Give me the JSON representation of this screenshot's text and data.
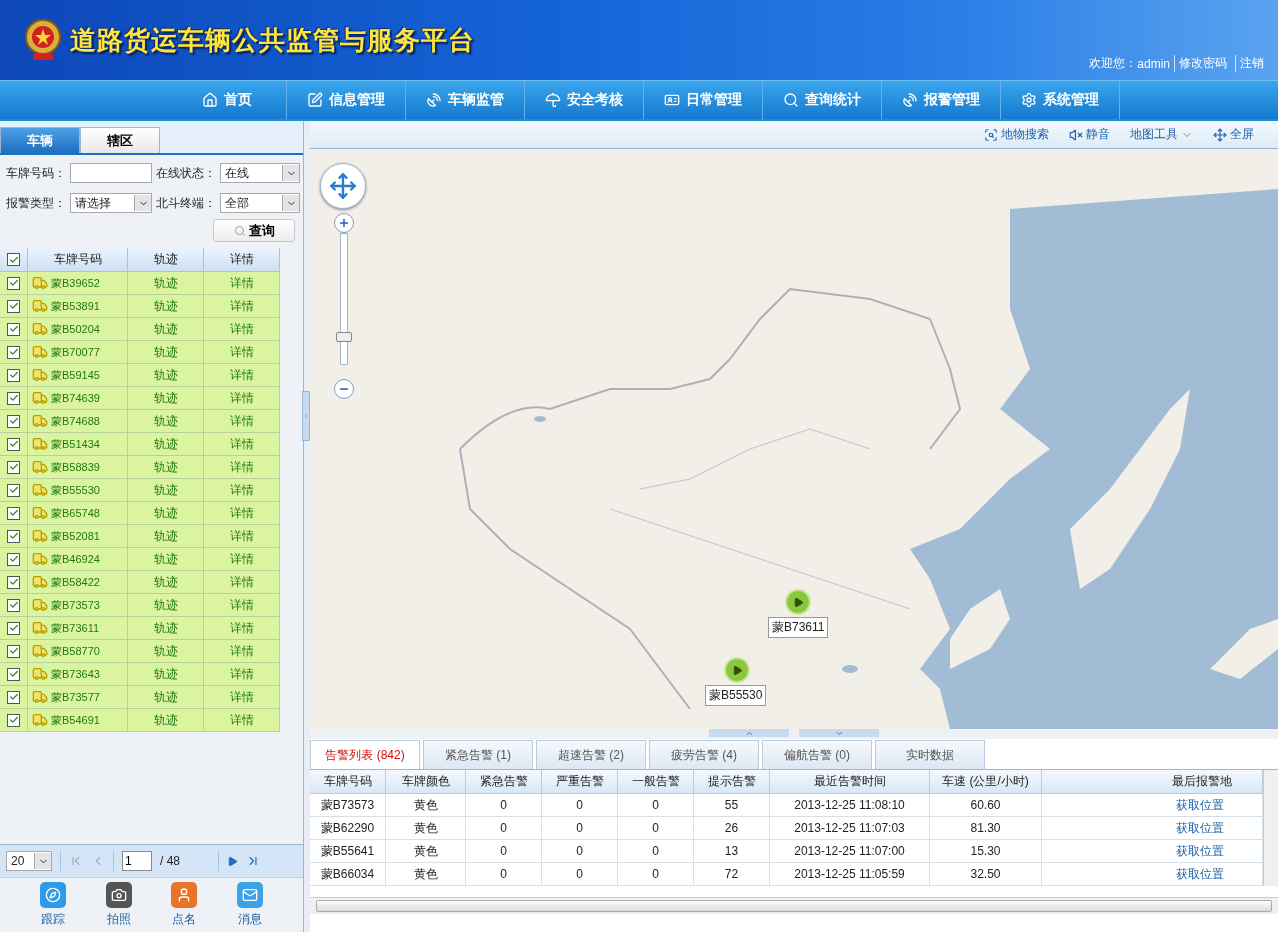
{
  "header": {
    "title": "道路货运车辆公共监管与服务平台",
    "welcome": "欢迎您：",
    "user": "admin",
    "links": [
      "修改密码",
      "注销"
    ]
  },
  "nav": [
    {
      "label": "首页"
    },
    {
      "label": "信息管理"
    },
    {
      "label": "车辆监管"
    },
    {
      "label": "安全考核"
    },
    {
      "label": "日常管理"
    },
    {
      "label": "查询统计"
    },
    {
      "label": "报警管理"
    },
    {
      "label": "系统管理"
    }
  ],
  "left_tabs": [
    {
      "label": "车辆",
      "selected": true
    },
    {
      "label": "辖区",
      "selected": false
    }
  ],
  "filters": {
    "plate_label": "车牌号码：",
    "status_label": "在线状态：",
    "status_value": "在线",
    "alarm_label": "报警类型：",
    "alarm_value": "请选择",
    "beidou_label": "北斗终端：",
    "beidou_value": "全部",
    "query_button": "查询"
  },
  "vehicle_table": {
    "columns": [
      "车牌号码",
      "轨迹",
      "详情"
    ],
    "all_checked": true,
    "rows": [
      {
        "plate": "蒙B39652",
        "track": "轨迹",
        "detail": "详情",
        "checked": true
      },
      {
        "plate": "蒙B53891",
        "track": "轨迹",
        "detail": "详情",
        "checked": true
      },
      {
        "plate": "蒙B50204",
        "track": "轨迹",
        "detail": "详情",
        "checked": true
      },
      {
        "plate": "蒙B70077",
        "track": "轨迹",
        "detail": "详情",
        "checked": true
      },
      {
        "plate": "蒙B59145",
        "track": "轨迹",
        "detail": "详情",
        "checked": true
      },
      {
        "plate": "蒙B74639",
        "track": "轨迹",
        "detail": "详情",
        "checked": true
      },
      {
        "plate": "蒙B74688",
        "track": "轨迹",
        "detail": "详情",
        "checked": true
      },
      {
        "plate": "蒙B51434",
        "track": "轨迹",
        "detail": "详情",
        "checked": true
      },
      {
        "plate": "蒙B58839",
        "track": "轨迹",
        "detail": "详情",
        "checked": true
      },
      {
        "plate": "蒙B55530",
        "track": "轨迹",
        "detail": "详情",
        "checked": true
      },
      {
        "plate": "蒙B65748",
        "track": "轨迹",
        "detail": "详情",
        "checked": true
      },
      {
        "plate": "蒙B52081",
        "track": "轨迹",
        "detail": "详情",
        "checked": true
      },
      {
        "plate": "蒙B46924",
        "track": "轨迹",
        "detail": "详情",
        "checked": true
      },
      {
        "plate": "蒙B58422",
        "track": "轨迹",
        "detail": "详情",
        "checked": true
      },
      {
        "plate": "蒙B73573",
        "track": "轨迹",
        "detail": "详情",
        "checked": true
      },
      {
        "plate": "蒙B73611",
        "track": "轨迹",
        "detail": "详情",
        "checked": true
      },
      {
        "plate": "蒙B58770",
        "track": "轨迹",
        "detail": "详情",
        "checked": true
      },
      {
        "plate": "蒙B73643",
        "track": "轨迹",
        "detail": "详情",
        "checked": true
      },
      {
        "plate": "蒙B73577",
        "track": "轨迹",
        "detail": "详情",
        "checked": true
      },
      {
        "plate": "蒙B54691",
        "track": "轨迹",
        "detail": "详情",
        "checked": true
      }
    ]
  },
  "pager": {
    "page_size": "20",
    "page": "1",
    "total": "/ 48"
  },
  "tools": [
    {
      "label": "跟踪"
    },
    {
      "label": "拍照"
    },
    {
      "label": "点名"
    },
    {
      "label": "消息"
    }
  ],
  "map_toolbar": [
    {
      "label": "地物搜索"
    },
    {
      "label": "静音"
    },
    {
      "label": "地图工具"
    },
    {
      "label": "全屏"
    }
  ],
  "map": {
    "zoom_slider": {
      "level": 0.2
    },
    "vehicles": [
      {
        "label": "蒙B73611"
      },
      {
        "label": "蒙B55530"
      }
    ]
  },
  "alarm_tabs": [
    {
      "label": "告警列表 (842)",
      "selected": true
    },
    {
      "label": "紧急告警 (1)",
      "selected": false
    },
    {
      "label": "超速告警 (2)",
      "selected": false
    },
    {
      "label": "疲劳告警 (4)",
      "selected": false
    },
    {
      "label": "偏航告警 (0)",
      "selected": false
    },
    {
      "label": "实时数据",
      "selected": false
    }
  ],
  "alarm_table": {
    "columns": [
      "车牌号码",
      "车牌颜色",
      "紧急告警",
      "严重告警",
      "一般告警",
      "提示告警",
      "最近告警时间",
      "车速 (公里/小时)",
      "最后报警地"
    ],
    "rows": [
      [
        "蒙B73573",
        "黄色",
        "0",
        "0",
        "0",
        "55",
        "2013-12-25 11:08:10",
        "60.60",
        "获取位置"
      ],
      [
        "蒙B62290",
        "黄色",
        "0",
        "0",
        "0",
        "26",
        "2013-12-25 11:07:03",
        "81.30",
        "获取位置"
      ],
      [
        "蒙B55641",
        "黄色",
        "0",
        "0",
        "0",
        "13",
        "2013-12-25 11:07:00",
        "15.30",
        "获取位置"
      ],
      [
        "蒙B66034",
        "黄色",
        "0",
        "0",
        "0",
        "72",
        "2013-12-25 11:05:59",
        "32.50",
        "获取位置"
      ]
    ]
  }
}
